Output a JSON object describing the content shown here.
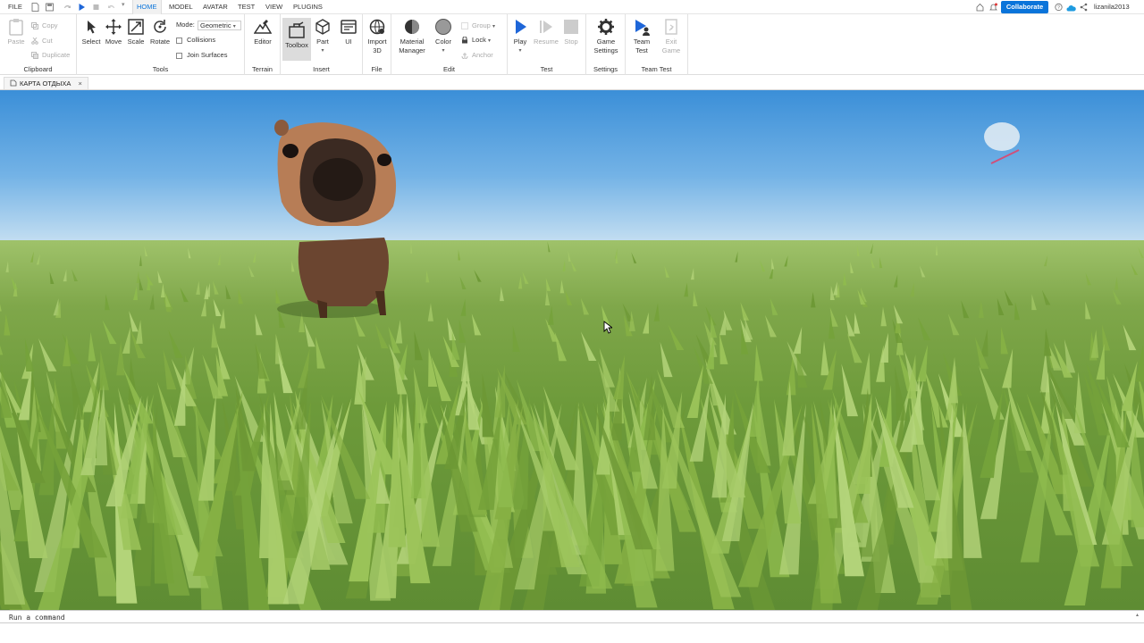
{
  "menubar": {
    "items": [
      {
        "label": "FILE"
      },
      {
        "label": "HOME",
        "active": true
      },
      {
        "label": "MODEL"
      },
      {
        "label": "AVATAR"
      },
      {
        "label": "TEST"
      },
      {
        "label": "VIEW"
      },
      {
        "label": "PLUGINS"
      }
    ],
    "collaborate_label": "Collaborate",
    "username": "lizanila2013",
    "accent_color": "#0a74da"
  },
  "ribbon": {
    "clipboard": {
      "label": "Clipboard",
      "paste": "Paste",
      "copy": "Copy",
      "cut": "Cut",
      "duplicate": "Duplicate"
    },
    "tools": {
      "label": "Tools",
      "select": "Select",
      "move": "Move",
      "scale": "Scale",
      "rotate": "Rotate",
      "mode_label": "Mode:",
      "mode_value": "Geometric",
      "collisions": "Collisions",
      "join_surfaces": "Join Surfaces"
    },
    "terrain": {
      "label": "Terrain",
      "editor": "Editor"
    },
    "insert": {
      "label": "Insert",
      "toolbox": "Toolbox",
      "part": "Part",
      "ui": "UI"
    },
    "file": {
      "label": "File",
      "import_line1": "Import",
      "import_line2": "3D"
    },
    "edit": {
      "label": "Edit",
      "material_line1": "Material",
      "material_line2": "Manager",
      "color": "Color",
      "group": "Group",
      "lock": "Lock",
      "anchor": "Anchor"
    },
    "test": {
      "label": "Test",
      "play": "Play",
      "resume": "Resume",
      "stop": "Stop"
    },
    "settings": {
      "label": "Settings",
      "game_line1": "Game",
      "game_line2": "Settings"
    },
    "team_test": {
      "label": "Team Test",
      "team_line1": "Team",
      "team_line2": "Test",
      "exit_line1": "Exit",
      "exit_line2": "Game"
    }
  },
  "tabs": {
    "document": "КАРТА ОТДЫХА",
    "close": "×"
  },
  "command_bar": {
    "placeholder": "Run a command"
  }
}
